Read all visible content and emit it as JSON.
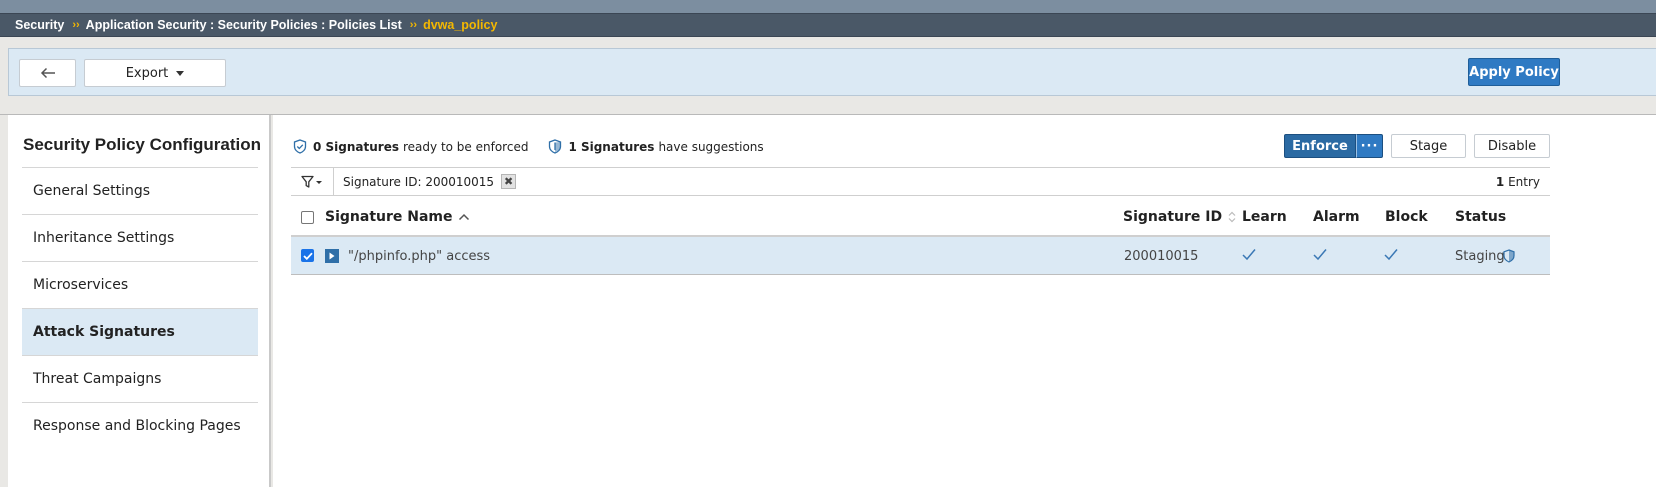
{
  "breadcrumb": {
    "items": [
      "Security",
      "Application Security : Security Policies : Policies List"
    ],
    "current": "dvwa_policy"
  },
  "toolbar": {
    "back_icon": "arrow-left-icon",
    "export_label": "Export",
    "apply_label": "Apply Policy"
  },
  "sidebar": {
    "title": "Security Policy Configuration",
    "items": [
      {
        "label": "General Settings",
        "active": false
      },
      {
        "label": "Inheritance Settings",
        "active": false
      },
      {
        "label": "Microservices",
        "active": false
      },
      {
        "label": "Attack Signatures",
        "active": true
      },
      {
        "label": "Threat Campaigns",
        "active": false
      },
      {
        "label": "Response and Blocking Pages",
        "active": false
      }
    ]
  },
  "summary": {
    "enforce_count": "0 Signatures",
    "enforce_text": "ready to be enforced",
    "suggest_count": "1 Signatures",
    "suggest_text": "have suggestions"
  },
  "actions": {
    "enforce": "Enforce",
    "more": "···",
    "stage": "Stage",
    "disable": "Disable"
  },
  "filter": {
    "chip_label": "Signature ID: 200010015",
    "chip_remove": "✖",
    "entries_count": "1",
    "entries_label": "Entry"
  },
  "table": {
    "columns": {
      "name": "Signature Name",
      "id": "Signature ID",
      "learn": "Learn",
      "alarm": "Alarm",
      "block": "Block",
      "status": "Status"
    },
    "rows": [
      {
        "checked": true,
        "name": "\"/phpinfo.php\" access",
        "id": "200010015",
        "learn": true,
        "alarm": true,
        "block": true,
        "status": "Staging"
      }
    ]
  },
  "colors": {
    "accent": "#2f7ac3",
    "crumb_highlight": "#f5b800",
    "selected_row": "#dbe9f4"
  }
}
